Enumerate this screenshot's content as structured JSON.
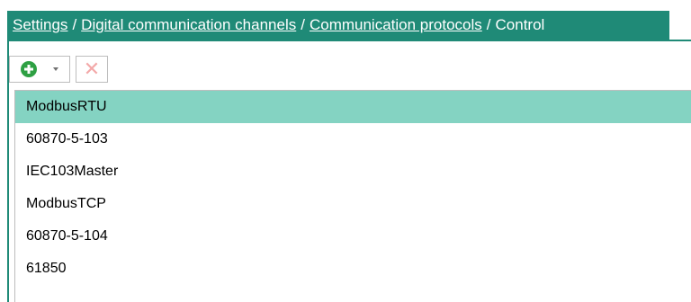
{
  "breadcrumb": {
    "items": [
      {
        "label": "Settings"
      },
      {
        "label": "Digital communication channels"
      },
      {
        "label": "Communication protocols"
      }
    ],
    "current": "Control",
    "separator": "/"
  },
  "toolbar": {
    "add_icon": "plus-circle-icon",
    "dropdown_icon": "chevron-down-icon",
    "delete_icon": "close-icon",
    "delete_glyph": "✕"
  },
  "list": {
    "items": [
      {
        "label": "ModbusRTU",
        "selected": true
      },
      {
        "label": "60870-5-103",
        "selected": false
      },
      {
        "label": "IEC103Master",
        "selected": false
      },
      {
        "label": "ModbusTCP",
        "selected": false
      },
      {
        "label": "60870-5-104",
        "selected": false
      },
      {
        "label": "61850",
        "selected": false
      }
    ]
  },
  "colors": {
    "accent": "#1f8a77",
    "selected_row": "#84d3c2",
    "add_green": "#2ea043",
    "delete_disabled": "#f3a9a9"
  }
}
